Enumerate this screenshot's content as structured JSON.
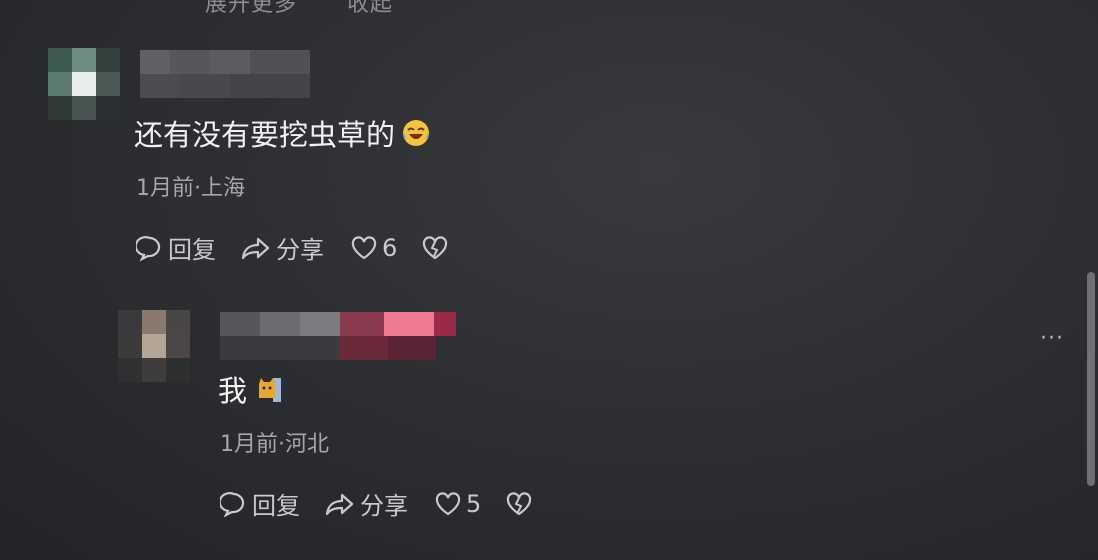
{
  "top_partial": {
    "expand_label": "展开更多",
    "collapse_label": "收起"
  },
  "comments": [
    {
      "text": "还有没有要挖虫草的",
      "emoji": "laughing-tears-emoji",
      "meta": "1月前·上海",
      "reply_label": "回复",
      "share_label": "分享",
      "likes": "6"
    },
    {
      "text": "我",
      "emoji": "cat-emoji",
      "meta": "1月前·河北",
      "reply_label": "回复",
      "share_label": "分享",
      "likes": "5"
    }
  ],
  "more_menu_label": "···",
  "colors": {
    "background": "#2e2f33",
    "text": "#f2f2f4",
    "meta": "#a6a7ab"
  }
}
